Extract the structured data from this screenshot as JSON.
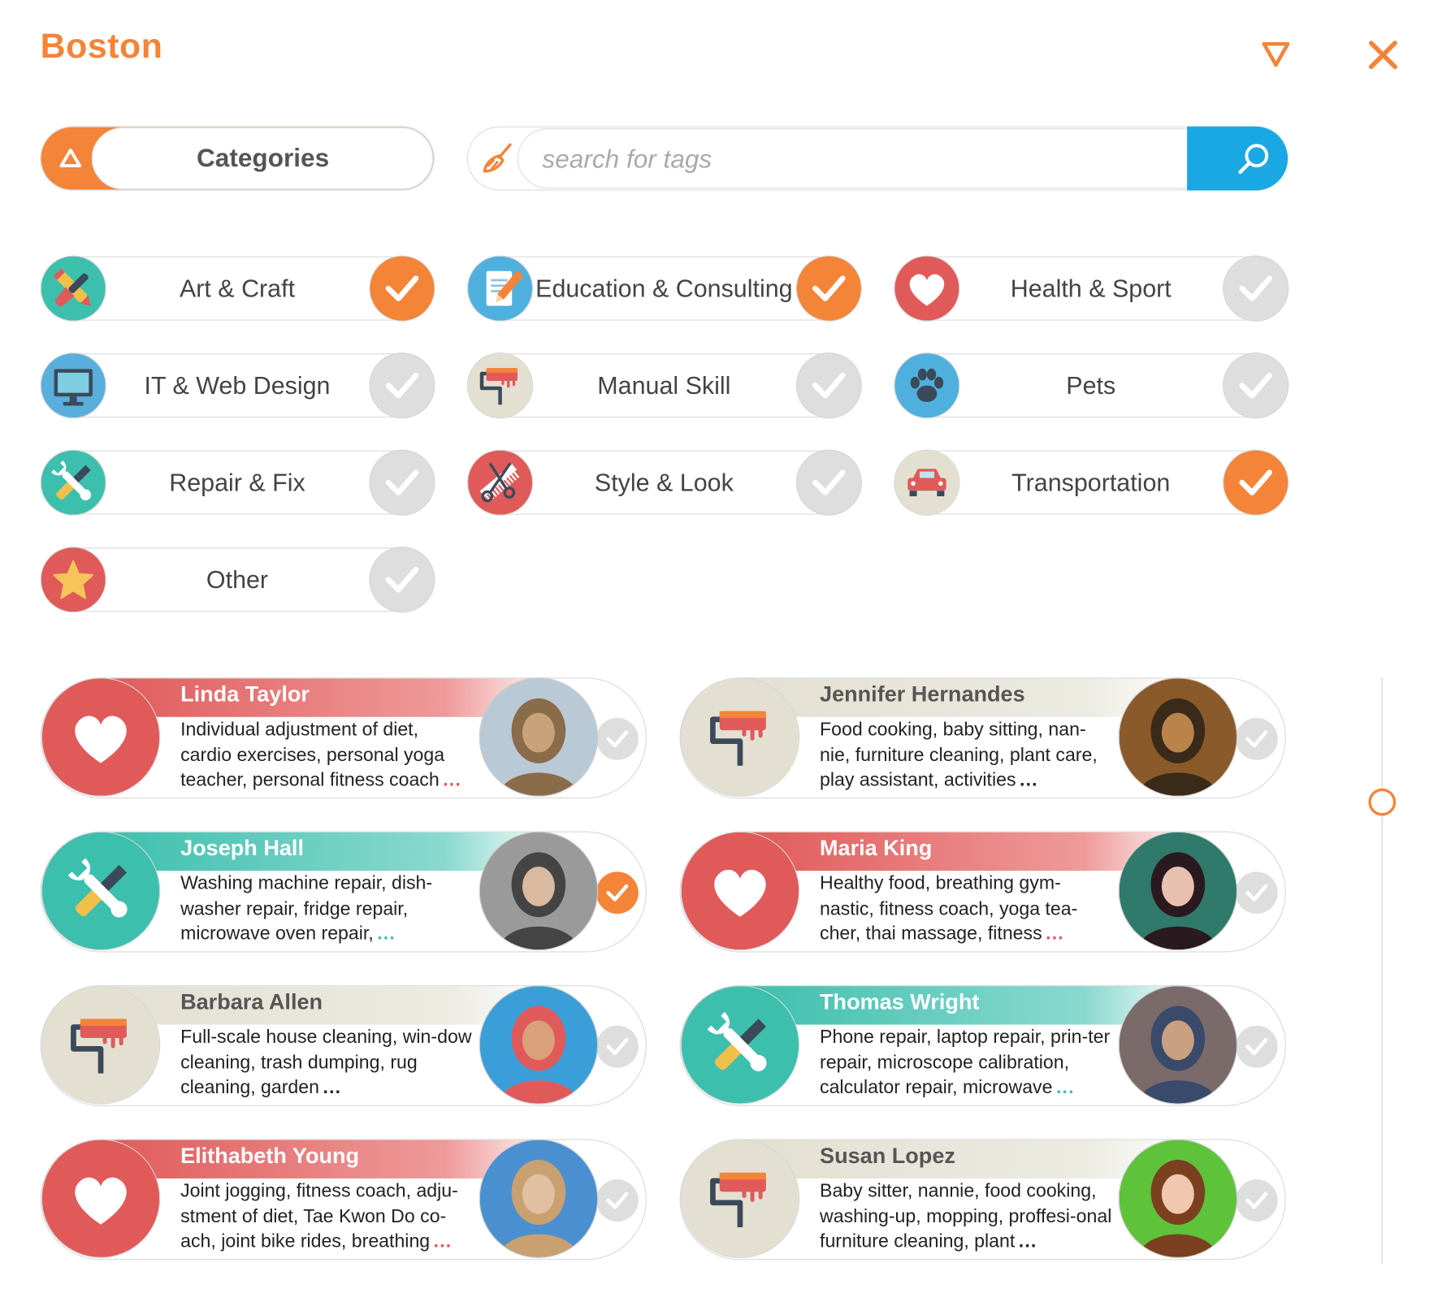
{
  "header": {
    "city": "Boston",
    "filter_icon": "filter-triangle-icon",
    "close_icon": "close-icon"
  },
  "categories_toggle": {
    "label": "Categories"
  },
  "search": {
    "placeholder": "search for tags",
    "value": ""
  },
  "colors": {
    "accent": "#f48438",
    "search_button": "#1aa8e4",
    "heart": "#e05a5a",
    "teal": "#3dbfae",
    "beige": "#e3e0d2"
  },
  "categories": [
    {
      "label": "Art & Craft",
      "icon": "art-craft-icon",
      "checked": true
    },
    {
      "label": "Education & Consulting",
      "icon": "education-icon",
      "checked": true
    },
    {
      "label": "Health & Sport",
      "icon": "heart-icon",
      "checked": false
    },
    {
      "label": "IT & Web Design",
      "icon": "monitor-icon",
      "checked": false
    },
    {
      "label": "Manual Skill",
      "icon": "paint-roller-icon",
      "checked": false
    },
    {
      "label": "Pets",
      "icon": "paw-icon",
      "checked": false
    },
    {
      "label": "Repair & Fix",
      "icon": "wrench-screwdriver-icon",
      "checked": false
    },
    {
      "label": "Style & Look",
      "icon": "comb-scissors-icon",
      "checked": false
    },
    {
      "label": "Transportation",
      "icon": "car-icon",
      "checked": true
    },
    {
      "label": "Other",
      "icon": "star-icon",
      "checked": false
    }
  ],
  "people": [
    {
      "name": "Linda Taylor",
      "desc": "Individual adjustment of diet, cardio exercises, personal yoga teacher, personal fitness coach",
      "more": "...",
      "category_icon": "heart-icon",
      "selected": false
    },
    {
      "name": "Jennifer Hernandes",
      "desc": "Food cooking, baby sitting, nan-nie, furniture cleaning, plant care, play assistant, activities",
      "more": "...",
      "category_icon": "paint-roller-icon",
      "selected": false
    },
    {
      "name": "Joseph Hall",
      "desc": "Washing machine repair, dish-washer repair, fridge repair, microwave oven repair,",
      "more": "...",
      "category_icon": "wrench-screwdriver-icon",
      "selected": true
    },
    {
      "name": "Maria King",
      "desc": "Healthy food, breathing gym-nastic, fitness coach, yoga tea-cher, thai massage, fitness",
      "more": "...",
      "category_icon": "heart-icon",
      "selected": false
    },
    {
      "name": "Barbara Allen",
      "desc": "Full-scale house cleaning, win-dow cleaning, trash dumping, rug cleaning, garden",
      "more": "...",
      "category_icon": "paint-roller-icon",
      "selected": false
    },
    {
      "name": "Thomas Wright",
      "desc": "Phone repair, laptop repair, prin-ter repair, microscope calibration, calculator repair, microwave",
      "more": "...",
      "category_icon": "wrench-screwdriver-icon",
      "selected": false
    },
    {
      "name": "Elithabeth Young",
      "desc": "Joint jogging, fitness coach, adju-stment of diet, Tae Kwon Do co-ach, joint bike rides, breathing",
      "more": "...",
      "category_icon": "heart-icon",
      "selected": false
    },
    {
      "name": "Susan Lopez",
      "desc": "Baby sitter, nannie, food cooking, washing-up, mopping, proffesi-onal furniture cleaning, plant",
      "more": "...",
      "category_icon": "paint-roller-icon",
      "selected": false
    }
  ]
}
